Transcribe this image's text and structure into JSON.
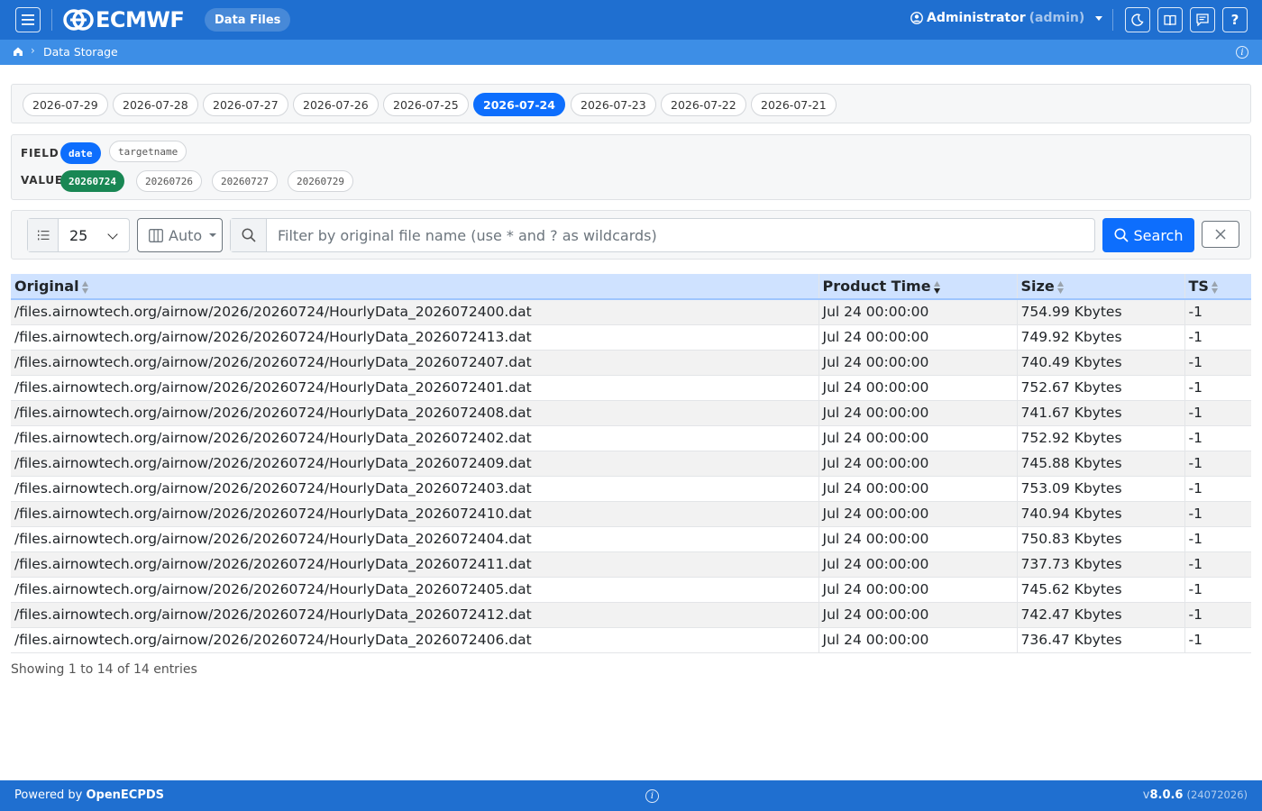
{
  "header": {
    "logo_text": "ECMWF",
    "section_badge": "Data Files",
    "user_name": "Administrator",
    "user_role": "(admin)",
    "icons": [
      "menu-icon",
      "moon-icon",
      "book-icon",
      "comment-icon",
      "question-icon"
    ]
  },
  "breadcrumb": {
    "current": "Data Storage"
  },
  "dates": [
    {
      "label": "2026-07-29",
      "active": false
    },
    {
      "label": "2026-07-28",
      "active": false
    },
    {
      "label": "2026-07-27",
      "active": false
    },
    {
      "label": "2026-07-26",
      "active": false
    },
    {
      "label": "2026-07-25",
      "active": false
    },
    {
      "label": "2026-07-24",
      "active": true
    },
    {
      "label": "2026-07-23",
      "active": false
    },
    {
      "label": "2026-07-22",
      "active": false
    },
    {
      "label": "2026-07-21",
      "active": false
    }
  ],
  "filters": {
    "field_label": "FIELD",
    "value_label": "VALUE",
    "fields": [
      {
        "label": "date",
        "active": true
      },
      {
        "label": "targetname",
        "active": false
      }
    ],
    "values": [
      {
        "label": "20260724",
        "active": true
      },
      {
        "label": "20260726",
        "active": false
      },
      {
        "label": "20260727",
        "active": false
      },
      {
        "label": "20260729",
        "active": false
      }
    ]
  },
  "controls": {
    "page_length": "25",
    "columns_button": "Auto",
    "search_placeholder": "Filter by original file name (use * and ? as wildcards)",
    "search_value": "",
    "search_button": "Search"
  },
  "table": {
    "columns": [
      "Original",
      "Product Time",
      "Size",
      "TS"
    ],
    "rows": [
      [
        "/files.airnowtech.org/airnow/2026/20260724/HourlyData_2026072400.dat",
        "Jul 24 00:00:00",
        "754.99 Kbytes",
        "-1"
      ],
      [
        "/files.airnowtech.org/airnow/2026/20260724/HourlyData_2026072413.dat",
        "Jul 24 00:00:00",
        "749.92 Kbytes",
        "-1"
      ],
      [
        "/files.airnowtech.org/airnow/2026/20260724/HourlyData_2026072407.dat",
        "Jul 24 00:00:00",
        "740.49 Kbytes",
        "-1"
      ],
      [
        "/files.airnowtech.org/airnow/2026/20260724/HourlyData_2026072401.dat",
        "Jul 24 00:00:00",
        "752.67 Kbytes",
        "-1"
      ],
      [
        "/files.airnowtech.org/airnow/2026/20260724/HourlyData_2026072408.dat",
        "Jul 24 00:00:00",
        "741.67 Kbytes",
        "-1"
      ],
      [
        "/files.airnowtech.org/airnow/2026/20260724/HourlyData_2026072402.dat",
        "Jul 24 00:00:00",
        "752.92 Kbytes",
        "-1"
      ],
      [
        "/files.airnowtech.org/airnow/2026/20260724/HourlyData_2026072409.dat",
        "Jul 24 00:00:00",
        "745.88 Kbytes",
        "-1"
      ],
      [
        "/files.airnowtech.org/airnow/2026/20260724/HourlyData_2026072403.dat",
        "Jul 24 00:00:00",
        "753.09 Kbytes",
        "-1"
      ],
      [
        "/files.airnowtech.org/airnow/2026/20260724/HourlyData_2026072410.dat",
        "Jul 24 00:00:00",
        "740.94 Kbytes",
        "-1"
      ],
      [
        "/files.airnowtech.org/airnow/2026/20260724/HourlyData_2026072404.dat",
        "Jul 24 00:00:00",
        "750.83 Kbytes",
        "-1"
      ],
      [
        "/files.airnowtech.org/airnow/2026/20260724/HourlyData_2026072411.dat",
        "Jul 24 00:00:00",
        "737.73 Kbytes",
        "-1"
      ],
      [
        "/files.airnowtech.org/airnow/2026/20260724/HourlyData_2026072405.dat",
        "Jul 24 00:00:00",
        "745.62 Kbytes",
        "-1"
      ],
      [
        "/files.airnowtech.org/airnow/2026/20260724/HourlyData_2026072412.dat",
        "Jul 24 00:00:00",
        "742.47 Kbytes",
        "-1"
      ],
      [
        "/files.airnowtech.org/airnow/2026/20260724/HourlyData_2026072406.dat",
        "Jul 24 00:00:00",
        "736.47 Kbytes",
        "-1"
      ]
    ],
    "entries_info": "Showing 1 to 14 of 14 entries"
  },
  "footer": {
    "powered_prefix": "Powered by",
    "powered_name": "OpenECPDS",
    "version_prefix": "v",
    "version": "8.0.6",
    "build": "(24072026)"
  },
  "colors": {
    "navbar": "#1f6fd0",
    "breadcrumb_bar": "#3d8ee6",
    "primary": "#0d6efd",
    "success": "#198754",
    "table_header": "#cfe2ff"
  }
}
